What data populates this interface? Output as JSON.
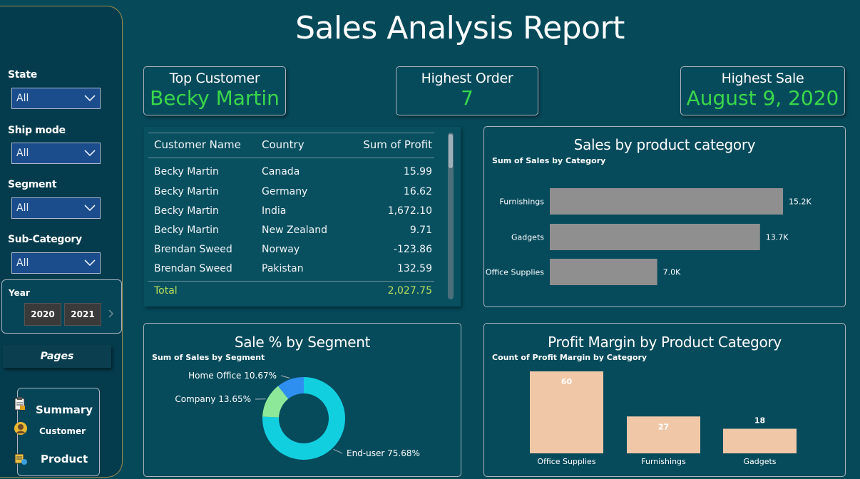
{
  "report": {
    "title": "Sales Analysis Report"
  },
  "filters": {
    "state": {
      "label": "State",
      "value": "All"
    },
    "ship_mode": {
      "label": "Ship mode",
      "value": "All"
    },
    "segment": {
      "label": "Segment",
      "value": "All"
    },
    "sub_category": {
      "label": "Sub-Category",
      "value": "All"
    },
    "year": {
      "label": "Year",
      "options": [
        "2020",
        "2021"
      ]
    }
  },
  "pages": {
    "label": "Pages",
    "items": [
      {
        "label": "Summary",
        "icon": "clipboard-icon"
      },
      {
        "label": "Customer",
        "icon": "user-icon"
      },
      {
        "label": "Product",
        "icon": "product-icon"
      }
    ]
  },
  "kpis": {
    "top_customer": {
      "label": "Top Customer",
      "value": "Becky Martin"
    },
    "highest_order": {
      "label": "Highest Order",
      "value": "7"
    },
    "highest_sale": {
      "label": "Highest Sale",
      "value": "August 9, 2020"
    }
  },
  "table": {
    "headers": [
      "Customer Name",
      "Country",
      "Sum of Profit"
    ],
    "rows": [
      [
        "Becky Martin",
        "Canada",
        "15.99"
      ],
      [
        "Becky Martin",
        "Germany",
        "16.62"
      ],
      [
        "Becky Martin",
        "India",
        "1,672.10"
      ],
      [
        "Becky Martin",
        "New Zealand",
        "9.71"
      ],
      [
        "Brendan Sweed",
        "Norway",
        "-123.86"
      ],
      [
        "Brendan Sweed",
        "Pakistan",
        "132.59"
      ]
    ],
    "total_label": "Total",
    "total_value": "2,027.75"
  },
  "colors": {
    "background": "#064a5a",
    "kpi_value": "#39d84a",
    "bar_gray": "#8f8f8f",
    "bar_peach": "#f0c8a8",
    "donut_enduser": "#12cfe0",
    "donut_company": "#8de89a",
    "donut_homeoffice": "#2f8ff0",
    "total_text": "#b8e05a"
  },
  "chart_data": [
    {
      "type": "bar",
      "orientation": "horizontal",
      "title": "Sales by product category",
      "subtitle": "Sum of Sales by Category",
      "categories": [
        "Furnishings",
        "Gadgets",
        "Office Supplies"
      ],
      "values": [
        15200,
        13700,
        7000
      ],
      "value_labels": [
        "15.2K",
        "13.7K",
        "7.0K"
      ],
      "xlim": [
        0,
        17800
      ]
    },
    {
      "type": "pie",
      "title": "Sale % by Segment",
      "subtitle": "Sum of Sales by Segment",
      "categories": [
        "End-user",
        "Company",
        "Home Office"
      ],
      "values": [
        75.68,
        13.65,
        10.67
      ],
      "value_labels": [
        "End-user 75.68%",
        "Company 13.65%",
        "Home Office 10.67%"
      ]
    },
    {
      "type": "bar",
      "orientation": "vertical",
      "title": "Profit Margin by Product Category",
      "subtitle": "Count of Profit Margin by Category",
      "categories": [
        "Office Supplies",
        "Furnishings",
        "Gadgets"
      ],
      "values": [
        60,
        27,
        18
      ],
      "value_labels": [
        "60",
        "27",
        "18"
      ],
      "ylim": [
        0,
        60
      ]
    }
  ]
}
